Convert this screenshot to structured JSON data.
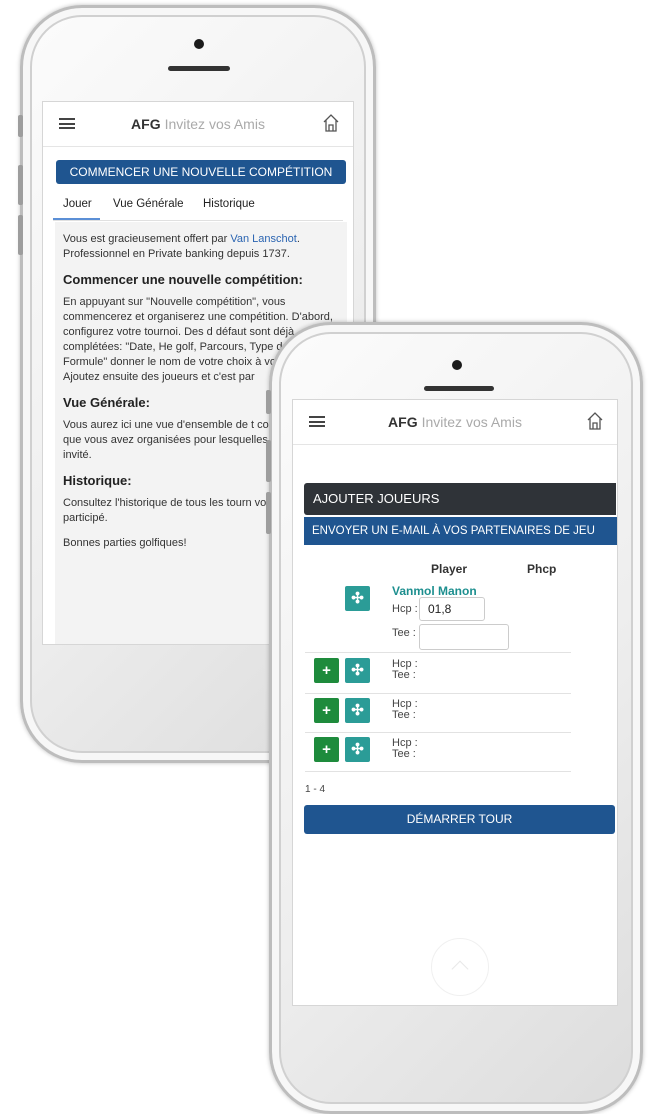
{
  "app": {
    "brand_bold": "AFG",
    "brand_light": "Invitez vos Amis"
  },
  "back_screen": {
    "cta_label": "COMMENCER UNE NOUVELLE COMPÉTITION",
    "tabs": [
      "Jouer",
      "Vue Générale",
      "Historique"
    ],
    "intro_before": "Vous est gracieusement offert par ",
    "intro_link": "Van Lanschot",
    "intro_after": ". Professionnel en Private banking depuis 1737.",
    "section1_title": "Commencer une nouvelle compétition:",
    "section1_text": "En appuyant sur \"Nouvelle compétition\", vous commencerez et organiserez une compétition. D'abord, configurez votre tournoi. Des d défaut sont déjà complétées: \"Date, He golf, Parcours, Type de jeu et Formule\" donner le nom de votre choix à votre co Ajoutez ensuite des joueurs et c'est par",
    "section2_title": "Vue Générale:",
    "section2_text": "Vous aurez ici une vue d'ensemble de t compétitions que vous avez organisées pour lesquelles vous êtes invité.",
    "section3_title": "Historique:",
    "section3_text": "Consultez l'historique de tous les tourn vous avez participé.",
    "closing": "Bonnes parties golfiques!"
  },
  "front_screen": {
    "section_title": "AJOUTER JOUEURS",
    "email_bar": "ENVOYER UN E-MAIL À VOS PARTENAIRES DE JEU",
    "columns": {
      "player": "Player",
      "phcp": "Phcp"
    },
    "player1": {
      "name": "Vanmol Manon",
      "hcp_label": "Hcp :",
      "hcp_value": "01,8",
      "tee_label": "Tee :",
      "tee_value": ""
    },
    "empty_rows": [
      {
        "hcp_label": "Hcp :",
        "tee_label": "Tee :"
      },
      {
        "hcp_label": "Hcp :",
        "tee_label": "Tee :"
      },
      {
        "hcp_label": "Hcp :",
        "tee_label": "Tee :"
      }
    ],
    "pager": "1 - 4",
    "start_label": "DÉMARRER TOUR"
  },
  "icons": {
    "menu": "hamburger-icon",
    "home": "home-icon",
    "add": "+",
    "move": "✣",
    "scroll_top": "chevron-up-icon"
  },
  "colors": {
    "primary_blue": "#1f5590",
    "dark_bar": "#2f3338",
    "green": "#1e8b3c",
    "teal": "#2b9c97",
    "player_name": "#1d8f8f",
    "link": "#2a64b1"
  }
}
